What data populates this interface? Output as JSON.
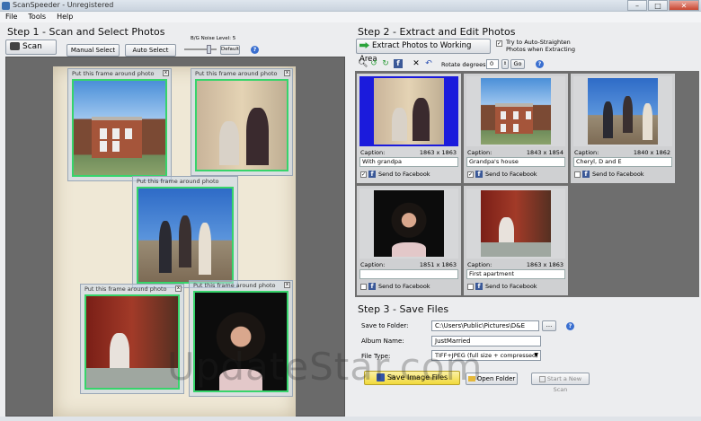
{
  "window": {
    "title": "ScanSpeeder - Unregistered",
    "minimize": "–",
    "maximize": "□",
    "close": "✕"
  },
  "menu": [
    "File",
    "Tools",
    "Help"
  ],
  "step1": {
    "heading": "Step 1 - Scan and Select Photos",
    "scan_label": "Scan",
    "manual_select": "Manual Select",
    "auto_select": "Auto Select",
    "noise_label": "B/G Noise Level: 5",
    "default_label": "Default",
    "frame_label": "Put this frame around photo",
    "frame_close": "x"
  },
  "step2": {
    "heading": "Step 2 - Extract and Edit Photos",
    "extract_label": "Extract Photos to Working Area",
    "auto_straighten": "Try to Auto-Straighten Photos when Extracting",
    "rotate_label": "Rotate degrees:",
    "rotate_value": "0",
    "go_label": "Go",
    "caption_label": "Caption:",
    "facebook_label": "Send to Facebook",
    "cards": [
      {
        "dims": "1863 x 1863",
        "caption": "With grandpa",
        "facebook": true,
        "selected": true
      },
      {
        "dims": "1843 x 1854",
        "caption": "Grandpa's house",
        "facebook": true,
        "selected": false
      },
      {
        "dims": "1840 x 1862",
        "caption": "Cheryl, D and E",
        "facebook": false,
        "selected": false
      },
      {
        "dims": "1851 x 1863",
        "caption": "",
        "facebook": false,
        "selected": false
      },
      {
        "dims": "1863 x 1863",
        "caption": "First apartment",
        "facebook": false,
        "selected": false
      }
    ]
  },
  "step3": {
    "heading": "Step 3 - Save Files",
    "save_folder_label": "Save to Folder:",
    "save_folder_value": "C:\\Users\\Public\\Pictures\\D&E",
    "browse_label": "...",
    "album_label": "Album Name:",
    "album_value": "JustMarried",
    "filetype_label": "File Type:",
    "filetype_value": "TIFF+JPEG (full size + compressed)",
    "save_button": "Save Image Files",
    "open_folder": "Open Folder",
    "new_scan": "Start a New Scan"
  },
  "watermark": "UpdateStar.com",
  "colors": {
    "frame_border": "#37d46b",
    "selected_thumb": "#1b1bdc",
    "facebook": "#3b5998",
    "save_highlight": "#f6e35a"
  }
}
